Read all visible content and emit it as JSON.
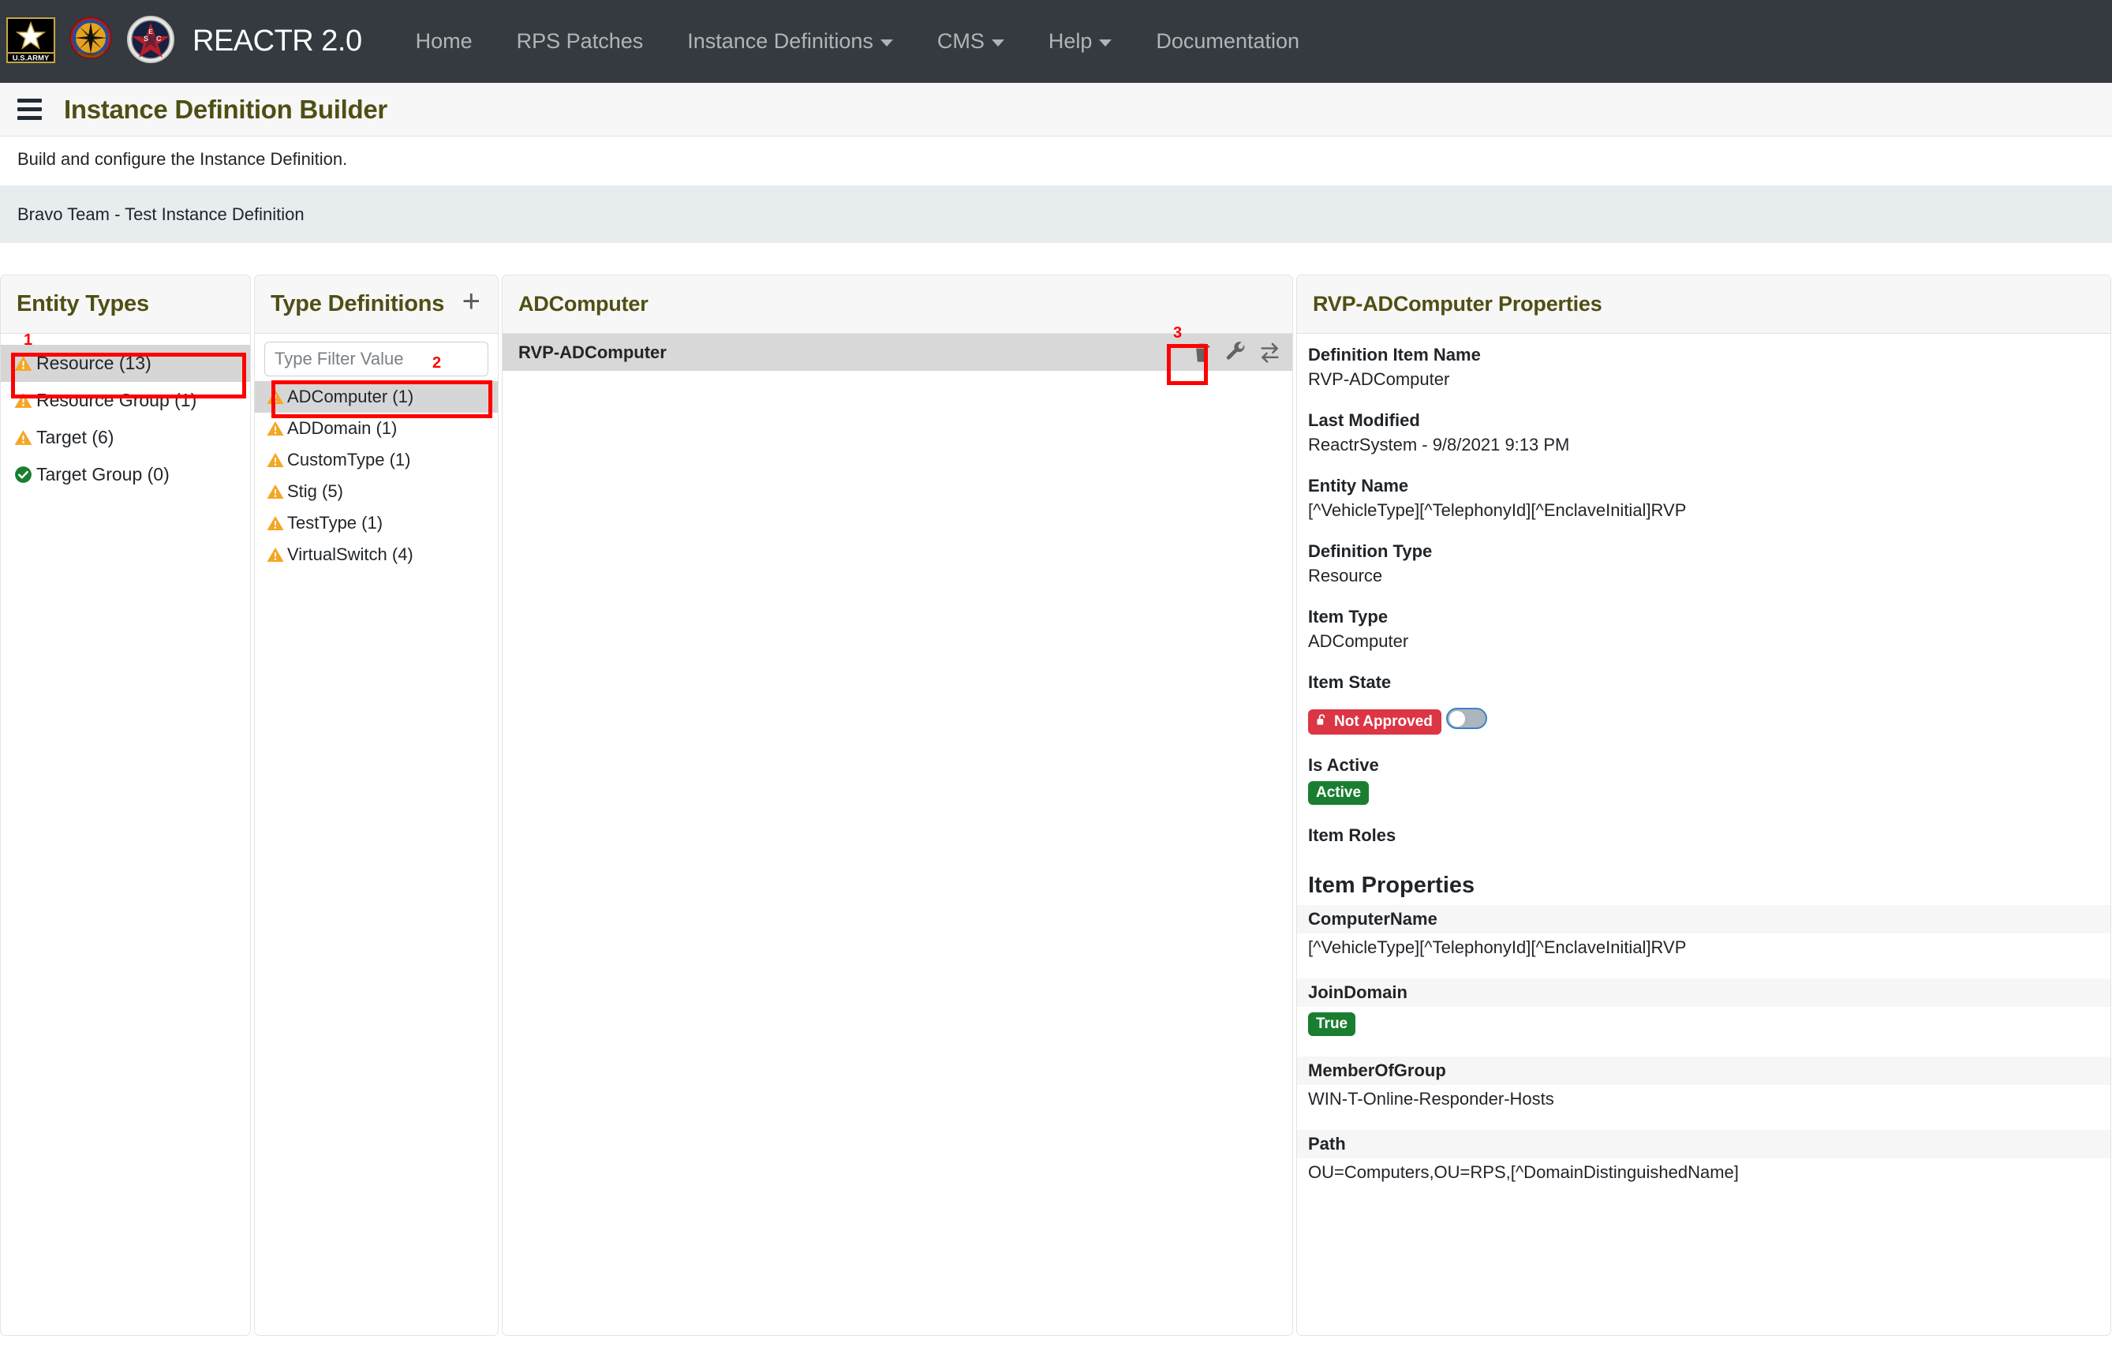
{
  "navbar": {
    "brand": "REACTR 2.0",
    "logos": [
      {
        "name": "us-army-logo",
        "alt": "U.S.ARMY"
      },
      {
        "name": "cecom-crest-logo",
        "alt": "Army Crest Emblem"
      },
      {
        "name": "star-seal-logo",
        "alt": "Star Seal Emblem"
      }
    ],
    "links": [
      {
        "label": "Home",
        "caret": false
      },
      {
        "label": "RPS Patches",
        "caret": false
      },
      {
        "label": "Instance Definitions",
        "caret": true
      },
      {
        "label": "CMS",
        "caret": true
      },
      {
        "label": "Help",
        "caret": true
      },
      {
        "label": "Documentation",
        "caret": false
      }
    ]
  },
  "header": {
    "title": "Instance Definition Builder",
    "subtitle": "Build and configure the Instance Definition.",
    "definition_bar": "Bravo Team - Test Instance Definition"
  },
  "entity_panel": {
    "title": "Entity Types",
    "items": [
      {
        "label": "Resource (13)",
        "status": "warning",
        "selected": true
      },
      {
        "label": "Resource Group (1)",
        "status": "warning",
        "selected": false
      },
      {
        "label": "Target (6)",
        "status": "warning",
        "selected": false
      },
      {
        "label": "Target Group (0)",
        "status": "ok",
        "selected": false
      }
    ]
  },
  "type_panel": {
    "title": "Type Definitions",
    "add_label": "+",
    "filter_placeholder": "Type Filter Value",
    "filter_value": "",
    "items": [
      {
        "label": "ADComputer (1)",
        "status": "warning",
        "selected": true
      },
      {
        "label": "ADDomain (1)",
        "status": "warning",
        "selected": false
      },
      {
        "label": "CustomType (1)",
        "status": "warning",
        "selected": false
      },
      {
        "label": "Stig (5)",
        "status": "warning",
        "selected": false
      },
      {
        "label": "TestType (1)",
        "status": "warning",
        "selected": false
      },
      {
        "label": "VirtualSwitch (4)",
        "status": "warning",
        "selected": false
      }
    ]
  },
  "items_panel": {
    "title": "ADComputer",
    "rows": [
      {
        "name": "RVP-ADComputer",
        "actions": [
          {
            "name": "delete-icon",
            "label": "Delete"
          },
          {
            "name": "wrench-icon",
            "label": "Configure"
          },
          {
            "name": "swap-arrows-icon",
            "label": "Swap"
          }
        ]
      }
    ]
  },
  "properties_panel": {
    "title": "RVP-ADComputer Properties",
    "fields": [
      {
        "label": "Definition Item Name",
        "value": "RVP-ADComputer",
        "type": "text"
      },
      {
        "label": "Last Modified",
        "value": "ReactrSystem - 9/8/2021 9:13 PM",
        "type": "text"
      },
      {
        "label": "Entity Name",
        "value": "[^VehicleType][^TelephonyId][^EnclaveInitial]RVP",
        "type": "text"
      },
      {
        "label": "Definition Type",
        "value": "Resource",
        "type": "text"
      },
      {
        "label": "Item Type",
        "value": "ADComputer",
        "type": "text"
      },
      {
        "label": "Item State",
        "value": "Not Approved",
        "type": "badge-danger-toggle"
      },
      {
        "label": "Is Active",
        "value": "Active",
        "type": "badge-success"
      },
      {
        "label": "Item Roles",
        "value": "",
        "type": "text"
      }
    ],
    "section_title": "Item Properties",
    "item_properties": [
      {
        "label": "ComputerName",
        "value": "[^VehicleType][^TelephonyId][^EnclaveInitial]RVP",
        "type": "text"
      },
      {
        "label": "JoinDomain",
        "value": "True",
        "type": "badge-success"
      },
      {
        "label": "MemberOfGroup",
        "value": "WIN-T-Online-Responder-Hosts",
        "type": "text"
      },
      {
        "label": "Path",
        "value": "OU=Computers,OU=RPS,[^DomainDistinguishedName]",
        "type": "text"
      }
    ]
  },
  "annotations": [
    {
      "number": "1",
      "target": "entity-item-resource"
    },
    {
      "number": "2",
      "target": "type-item-adcomputer"
    },
    {
      "number": "3",
      "target": "delete-icon"
    }
  ],
  "colors": {
    "navbar_bg": "#343a40",
    "title_olive": "#4f4f15",
    "warning_amber": "#f5a623",
    "ok_green": "#1a7e31",
    "danger_red": "#dc3545",
    "annotation_red": "#ff0000",
    "selected_gray": "#d6d6d6"
  }
}
